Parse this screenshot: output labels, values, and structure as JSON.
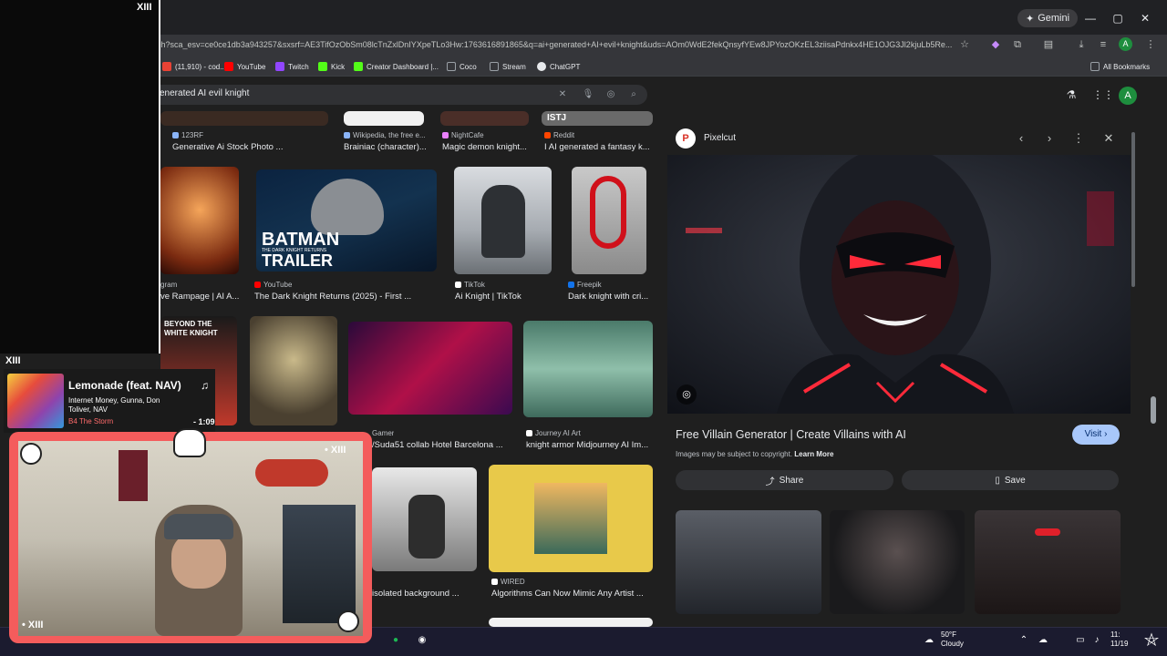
{
  "browser": {
    "gemini_label": "Gemini",
    "url": "ch?sca_esv=ce0ce1db3a943257&sxsrf=AE3TifOzObSm08lcTnZxlDnIYXpeTLo3Hw:1763616891865&q=ai+generated+AI+evil+knight&uds=AOm0WdE2fekQnsyfYEw8JPYozOKzEL3ziisaPdnkx4HE1OJG3Jl2kjuLb5Re...",
    "profile_initial": "A",
    "bookmarks": [
      {
        "label": "(11,910) - cod...",
        "color": "#ea4335"
      },
      {
        "label": "YouTube",
        "color": "#ff0000"
      },
      {
        "label": "Twitch",
        "color": "#9146ff"
      },
      {
        "label": "Kick",
        "color": "#53fc18"
      },
      {
        "label": "Creator Dashboard |...",
        "color": "#53fc18"
      },
      {
        "label": "Coco",
        "color": "#9aa0a6"
      },
      {
        "label": "Stream",
        "color": "#9aa0a6"
      },
      {
        "label": "ChatGPT",
        "color": "#e8eaed"
      }
    ],
    "all_bookmarks": "All Bookmarks"
  },
  "search": {
    "query": "enerated AI evil knight",
    "user_initial": "A"
  },
  "results": {
    "row1": [
      {
        "source": "123RF",
        "caption": "Generative Ai Stock Photo ..."
      },
      {
        "source": "Wikipedia, the free e...",
        "caption": "Brainiac (character)..."
      },
      {
        "source": "NightCafe",
        "caption": "Magic demon knight..."
      },
      {
        "source": "Reddit",
        "caption": "I AI generated a fantasy k...",
        "tag": "ISTJ"
      }
    ],
    "row2": [
      {
        "source": "gram",
        "caption": "ve Rampage | AI A..."
      },
      {
        "source": "YouTube",
        "caption": "The Dark Knight Returns (2025) - First ...",
        "thumb_line1": "BATMAN",
        "thumb_line2": "THE DARK KNIGHT RETURNS",
        "thumb_line3": "TRAILER"
      },
      {
        "source": "TikTok",
        "caption": "Ai Knight | TikTok"
      },
      {
        "source": "Freepik",
        "caption": "Dark knight with cri..."
      }
    ],
    "row3": [
      {
        "source": "Gamer",
        "caption": "/Suda51 collab Hotel Barcelona ...",
        "thumb_text": "BEYOND THE WHITE KNIGHT"
      },
      {
        "source": "Journey AI Art",
        "caption": "knight armor Midjourney AI Im..."
      }
    ],
    "row4": [
      {
        "caption": "isolated background ..."
      },
      {
        "source": "WIRED",
        "caption": "Algorithms Can Now Mimic Any Artist ..."
      }
    ]
  },
  "panel": {
    "site_name": "Pixelcut",
    "site_initial": "P",
    "title": "Free Villain Generator | Create Villains with AI",
    "visit_label": "Visit",
    "copyright_text": "Images may be subject to copyright.",
    "learn_more": "Learn More",
    "share_label": "Share",
    "save_label": "Save"
  },
  "taskbar": {
    "temp": "50°F",
    "condition": "Cloudy",
    "time": "11:",
    "date": "11/19"
  },
  "overlay": {
    "song_title": "Lemonade (feat. NAV)",
    "song_artists": "Internet Money, Gunna, Don Toliver, NAV",
    "album": "B4 The Storm",
    "elapsed": "- 1:09",
    "brand": "XIII"
  }
}
